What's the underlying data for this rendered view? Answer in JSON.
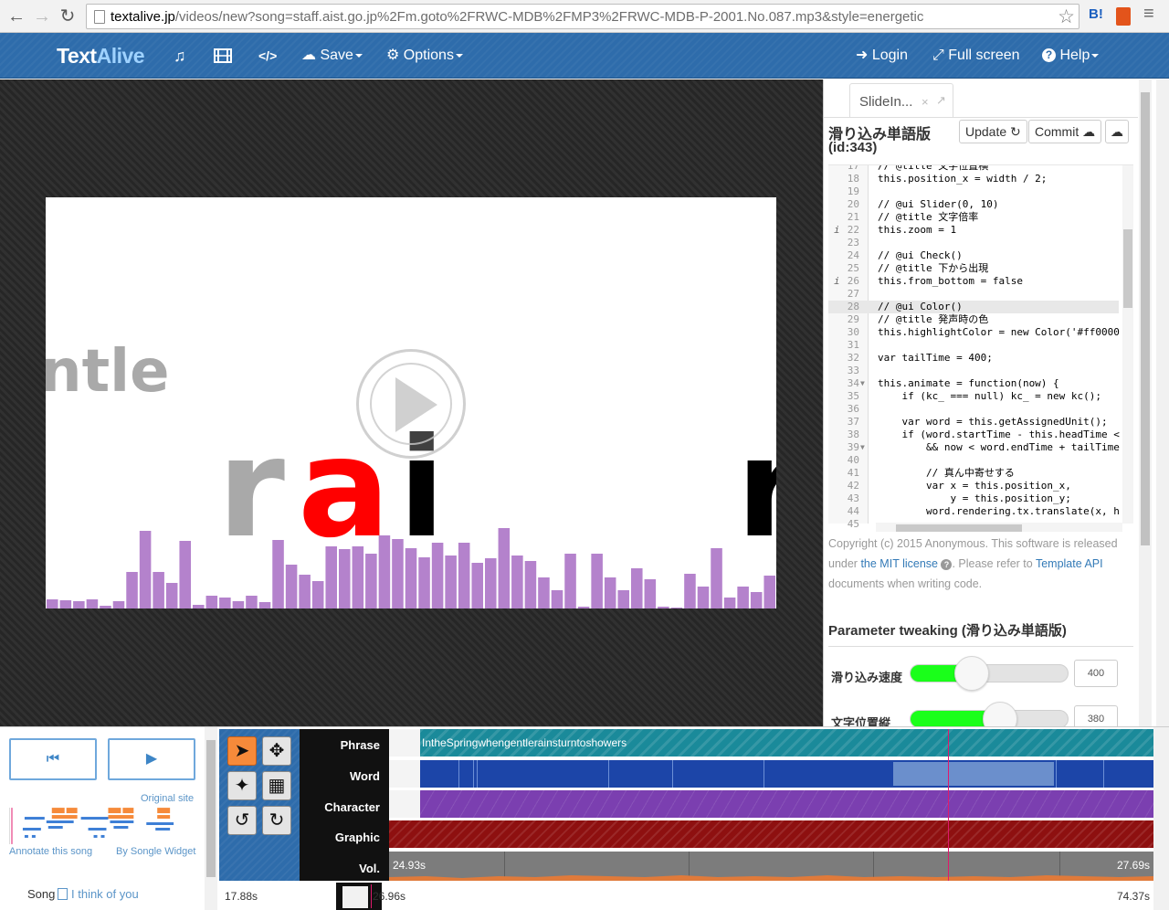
{
  "browser": {
    "url_host": "textalive.jp",
    "url_path": "/videos/new?song=staff.aist.go.jp%2Fm.goto%2FRWC-MDB%2FMP3%2FRWC-MDB-P-2001.No.087.mp3&style=energetic",
    "ext_b": "B!"
  },
  "navbar": {
    "brand_text": "Text",
    "brand_alive": "Alive",
    "music_icon": "music-icon",
    "film_icon": "film-icon",
    "code_icon": "code-icon",
    "save_label": "Save",
    "options_label": "Options",
    "login_label": "Login",
    "fullscreen_label": "Full screen",
    "help_label": "Help"
  },
  "stage": {
    "lyric_back": "ntle",
    "lyric_r": "r",
    "lyric_a": "a",
    "lyric_i": "i",
    "lyric_n": "r",
    "lyric_r_color": "#a9a9a9",
    "lyric_a_color": "#ff0000",
    "bar_color": "#b482cc",
    "spectrum": [
      10,
      9,
      8,
      10,
      3,
      8,
      40,
      85,
      40,
      28,
      74,
      4,
      14,
      12,
      8,
      14,
      7,
      75,
      48,
      37,
      30,
      68,
      65,
      68,
      60,
      80,
      76,
      66,
      56,
      72,
      58,
      72,
      50,
      55,
      88,
      58,
      52,
      34,
      20,
      60,
      2,
      60,
      34,
      20,
      44,
      32,
      2,
      1,
      38,
      24,
      66,
      12,
      24,
      18,
      36
    ]
  },
  "editor": {
    "tab_label": "SlideIn...",
    "template_title": "滑り込み単語版",
    "template_id": "(id:343)",
    "update_label": "Update",
    "commit_label": "Commit",
    "lines": [
      {
        "n": "17",
        "t": "// @title 文字位置横",
        "cls": "c-com"
      },
      {
        "n": "18",
        "t": "this.position_x = width / 2;",
        "cls": ""
      },
      {
        "n": "19",
        "t": "",
        "cls": ""
      },
      {
        "n": "20",
        "t": "// @ui Slider(0, 10)",
        "cls": "c-com"
      },
      {
        "n": "21",
        "t": "// @title 文字倍率",
        "cls": "c-com"
      },
      {
        "n": "22",
        "t": "this.zoom = 1",
        "cls": "",
        "i": true
      },
      {
        "n": "23",
        "t": "",
        "cls": ""
      },
      {
        "n": "24",
        "t": "// @ui Check()",
        "cls": "c-com"
      },
      {
        "n": "25",
        "t": "// @title 下から出現",
        "cls": "c-com"
      },
      {
        "n": "26",
        "t": "this.from_bottom = false",
        "cls": "",
        "i": true
      },
      {
        "n": "27",
        "t": "",
        "cls": ""
      },
      {
        "n": "28",
        "t": "// @ui Color()",
        "cls": "c-com",
        "active": true
      },
      {
        "n": "29",
        "t": "// @title 発声時の色",
        "cls": "c-com"
      },
      {
        "n": "30",
        "t": "this.highlightColor = new Color('#ff0000",
        "cls": ""
      },
      {
        "n": "31",
        "t": "",
        "cls": ""
      },
      {
        "n": "32",
        "t": "var tailTime = 400;",
        "cls": ""
      },
      {
        "n": "33",
        "t": "",
        "cls": ""
      },
      {
        "n": "34",
        "t": "this.animate = function(now) {",
        "cls": "",
        "fold": true
      },
      {
        "n": "35",
        "t": "    if (kc_ === null) kc_ = new kc();",
        "cls": ""
      },
      {
        "n": "36",
        "t": "",
        "cls": ""
      },
      {
        "n": "37",
        "t": "    var word = this.getAssignedUnit();",
        "cls": ""
      },
      {
        "n": "38",
        "t": "    if (word.startTime - this.headTime <",
        "cls": ""
      },
      {
        "n": "39",
        "t": "        && now < word.endTime + tailTime",
        "cls": "",
        "fold": true
      },
      {
        "n": "40",
        "t": "",
        "cls": ""
      },
      {
        "n": "41",
        "t": "        // 真ん中寄せする",
        "cls": "c-com"
      },
      {
        "n": "42",
        "t": "        var x = this.position_x,",
        "cls": ""
      },
      {
        "n": "43",
        "t": "            y = this.position_y;",
        "cls": ""
      },
      {
        "n": "44",
        "t": "        word.rendering.tx.translate(x, h",
        "cls": ""
      },
      {
        "n": "45",
        "t": "",
        "cls": ""
      }
    ],
    "copyright_1": "Copyright (c) 2015 Anonymous. This software is released under ",
    "copyright_link": "the MIT license",
    "copyright_2": ". Please refer to ",
    "copyright_link2": "Template API",
    "copyright_3": " documents when writing code."
  },
  "params": {
    "title": "Parameter tweaking (滑り込み単語版)",
    "items": [
      {
        "label": "滑り込み速度",
        "value": "400",
        "fraction": 0.39
      },
      {
        "label": "文字位置縦",
        "value": "380",
        "fraction": 0.57
      }
    ]
  },
  "bottom": {
    "prev_icon": "⏮",
    "play_icon": "▶",
    "original_site": "Original site",
    "annotate": "Annotate this song",
    "by_songle": "By Songle Widget",
    "song_label": "Song",
    "song_name": "I think of you",
    "tracks": [
      "Phrase",
      "Word",
      "Character",
      "Graphic",
      "Vol."
    ],
    "phrase_text": "IntheSpringwhengentlerainsturntoshowers",
    "vol_left": "24.93s",
    "vol_right": "27.69s",
    "ruler_start": "17.88s",
    "ruler_current": "26.96s",
    "ruler_end": "74.37s",
    "colors": {
      "phrase": "#1a8a9a",
      "word": "#1c45a8",
      "character": "#7b3fb0",
      "graphic": "#8e1010",
      "volume": "#e07a3a",
      "playhead": "#e0186c",
      "tool_selected": "#f68a3a"
    }
  }
}
